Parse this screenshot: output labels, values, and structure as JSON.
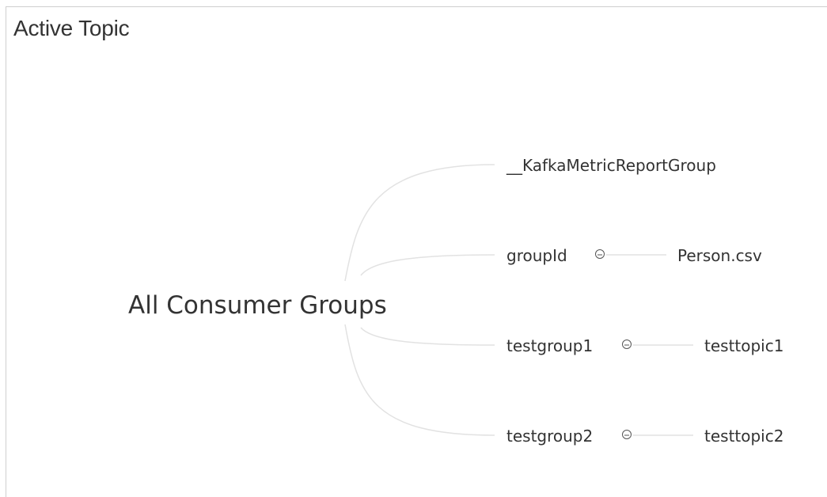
{
  "panel": {
    "title": "Active Topic"
  },
  "tree": {
    "root": {
      "label": "All Consumer Groups"
    },
    "groups": [
      {
        "label": "__KafkaMetricReportGroup",
        "topics": []
      },
      {
        "label": "groupId",
        "topics": [
          "Person.csv"
        ]
      },
      {
        "label": "testgroup1",
        "topics": [
          "testtopic1"
        ]
      },
      {
        "label": "testgroup2",
        "topics": [
          "testtopic2"
        ]
      }
    ],
    "colors": {
      "link": "#e2e2e2",
      "text": "#333333",
      "toggle": "#555555"
    }
  }
}
